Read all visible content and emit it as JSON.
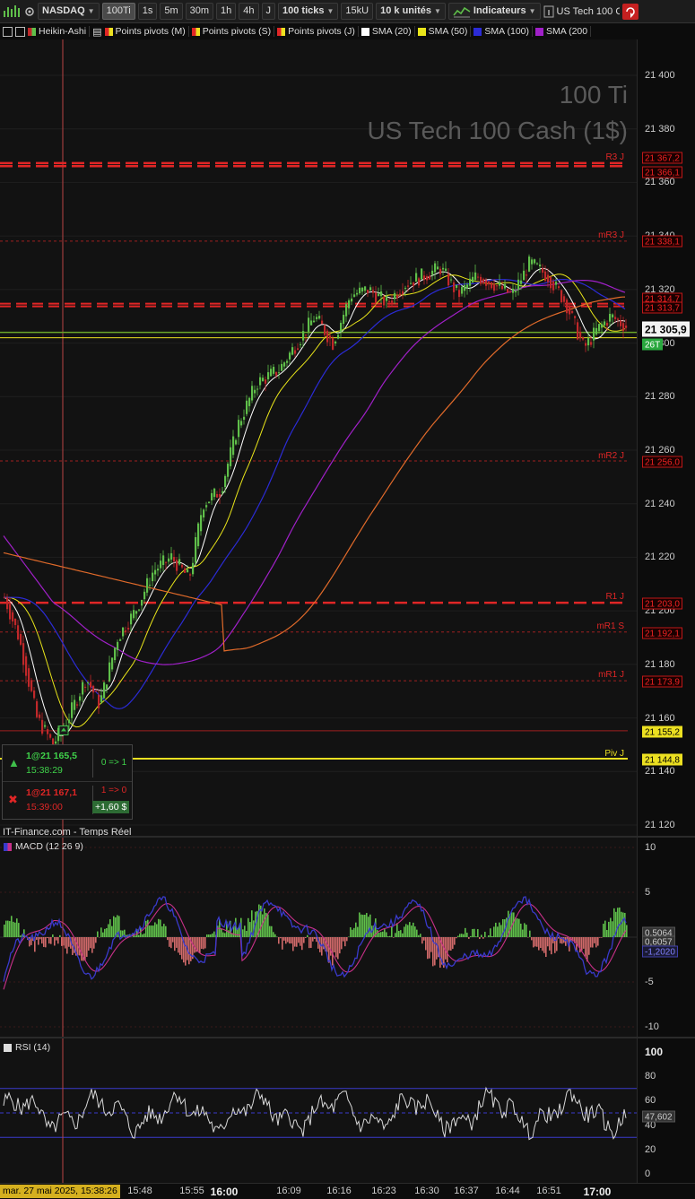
{
  "toolbar": {
    "symbol": "NASDAQ",
    "timeframes": [
      "100Ti",
      "1s",
      "5m",
      "30m",
      "1h",
      "4h",
      "J"
    ],
    "active_timeframe": "100Ti",
    "ticks": "100 ticks",
    "volume": "15kU",
    "units": "10 k unités",
    "indicators": "Indicateurs",
    "instrument": "US Tech 100 C"
  },
  "legend": [
    "Heikin-Ashi",
    "Points pivots (M)",
    "Points pivots (S)",
    "Points pivots (J)",
    "SMA (20)",
    "SMA (50)",
    "SMA (100)",
    "SMA (200"
  ],
  "colors": {
    "sma20": "#ffffff",
    "sma50": "#e9e51a",
    "sma100": "#2b2bd6",
    "sma200": "#a020c8",
    "sma_extra": "#e06a2a",
    "pivot": "#e02626",
    "piv": "#ece021",
    "up": "#5fbf4a",
    "down": "#c0282a"
  },
  "watermark": {
    "line1": "100 Ti",
    "line2": "US Tech 100 Cash (1$)"
  },
  "price_axis": {
    "ticks": [
      "21 400",
      "21 380",
      "21 360",
      "21 340",
      "21 320",
      "21 300",
      "21 280",
      "21 260",
      "21 240",
      "21 220",
      "21 200",
      "21 180",
      "21 160",
      "21 140",
      "21 120"
    ]
  },
  "levels": [
    {
      "label": "R3 J",
      "price": "21 367,2",
      "style": "dashed-thick"
    },
    {
      "label": "",
      "price": "21 366,1",
      "style": "dashed-thick"
    },
    {
      "label": "mR3 J",
      "price": "21 338,1",
      "style": "dotted"
    },
    {
      "label": "",
      "price": "21 314,7",
      "style": "dashed"
    },
    {
      "label": "",
      "price": "21 313,7",
      "style": "dashed"
    },
    {
      "label": "mR2 J",
      "price": "21 256,0",
      "style": "dotted"
    },
    {
      "label": "R1 J",
      "price": "21 203,0",
      "style": "dashed-thick"
    },
    {
      "label": "mR1 S",
      "price": "21 192,1",
      "style": "dotted"
    },
    {
      "label": "mR1 J",
      "price": "21 173,9",
      "style": "dotted"
    },
    {
      "label": "",
      "price": "21 155,2",
      "style": "solid"
    },
    {
      "label": "Piv J",
      "price": "21 144,8",
      "style": "yellow"
    }
  ],
  "last_price": "21 305,9",
  "countdown": "26T",
  "trades": [
    {
      "line1": "1@21 165,5",
      "line2": "15:38:29",
      "action": "0 => 1",
      "pnl": ""
    },
    {
      "line1": "1@21 167,1",
      "line2": "15:39:00",
      "action": "1 => 0",
      "pnl": "+1,60 $"
    }
  ],
  "source": "IT-Finance.com - Temps Réel",
  "macd": {
    "title": "MACD (12 26 9)",
    "ticks": [
      "10",
      "5",
      "0",
      "-5",
      "-10"
    ],
    "values": [
      "0,5064",
      "0,6057",
      "-1,2020"
    ]
  },
  "rsi": {
    "title": "RSI (14)",
    "ticks": [
      "100",
      "80",
      "60",
      "40",
      "20",
      "0"
    ],
    "value": "47,602"
  },
  "time_axis": {
    "cursor": "mar. 27 mai 2025, 15:38:26",
    "labels": [
      "15:48",
      "15:55",
      "16:00",
      "16:09",
      "16:16",
      "16:23",
      "16:30",
      "16:37",
      "16:44",
      "16:51",
      "17:00"
    ]
  }
}
